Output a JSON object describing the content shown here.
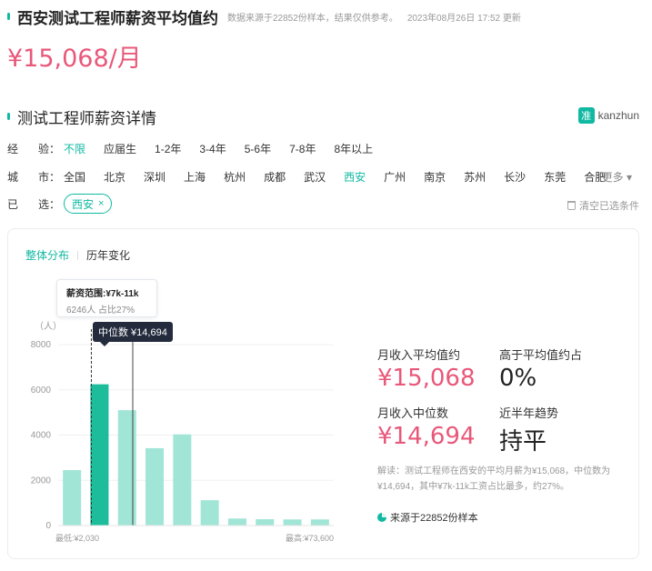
{
  "header": {
    "title": "西安测试工程师薪资平均值约",
    "source_note": "数据来源于22852份样本，结果仅供参考。",
    "updated": "2023年08月26日 17:52 更新"
  },
  "average_big": "¥15,068/月",
  "section": {
    "title": "测试工程师薪资详情"
  },
  "brand": {
    "logo_text": "准",
    "name": "kanzhun"
  },
  "filters": {
    "experience": {
      "label_a": "经",
      "label_b": "验：",
      "options": [
        "不限",
        "应届生",
        "1-2年",
        "3-4年",
        "5-6年",
        "7-8年",
        "8年以上"
      ],
      "active": "不限"
    },
    "city": {
      "label_a": "城",
      "label_b": "市：",
      "options": [
        "全国",
        "北京",
        "深圳",
        "上海",
        "杭州",
        "成都",
        "武汉",
        "西安",
        "广州",
        "南京",
        "苏州",
        "长沙",
        "东莞",
        "合肥"
      ],
      "active": "西安",
      "more": "更多"
    },
    "selected": {
      "label_a": "已",
      "label_b": "选：",
      "chips": [
        "西安"
      ],
      "clear": "清空已选条件"
    }
  },
  "tabs": [
    "整体分布",
    "历年变化"
  ],
  "tooltip": {
    "title": "薪资范围:¥7k-11k",
    "detail": "6246人 占比27%"
  },
  "median_tag": "中位数 ¥14,694",
  "stats": {
    "avg_label": "月收入平均值约",
    "avg_value": "¥15,068",
    "above_label": "高于平均值约占",
    "above_value": "0%",
    "median_label": "月收入中位数",
    "median_value": "¥14,694",
    "trend_label": "近半年趋势",
    "trend_value": "持平"
  },
  "description": "解读：测试工程师在西安的平均月薪为¥15,068，中位数为¥14,694，其中¥7k-11k工资占比最多，约27%。",
  "source": "来源于22852份样本",
  "colors": {
    "accent": "#11b9a2",
    "pink": "#e8587a",
    "bar": "#a0e5d6",
    "bar_highlight": "#1dbd9c"
  },
  "chart_data": {
    "type": "bar",
    "ylabel": "（人）",
    "ylim": [
      0,
      8000
    ],
    "yticks": [
      "0",
      "2000",
      "4000",
      "6000",
      "8000"
    ],
    "values": [
      2450,
      6246,
      5100,
      3420,
      4030,
      1120,
      310,
      280,
      270,
      270
    ],
    "highlight_index": 1,
    "min_label": "最低:¥2,030",
    "max_label": "最高:¥73,600"
  }
}
